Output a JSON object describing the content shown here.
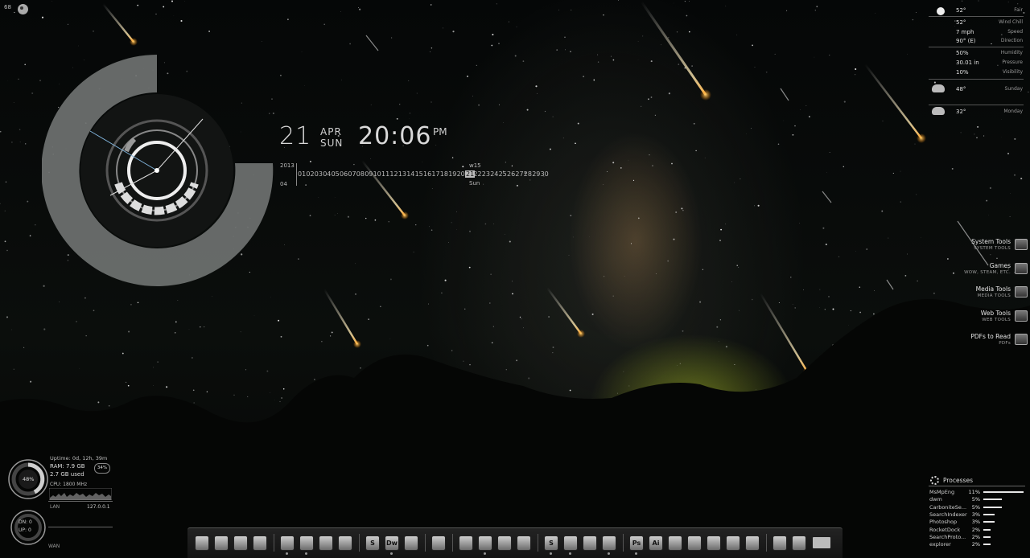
{
  "top_left": {
    "counter": "68"
  },
  "clock": {
    "date_num": "21",
    "month": "APR",
    "day": "SUN",
    "time": "20:06",
    "ampm": "PM",
    "year": "2013",
    "month_num": "04",
    "week": "w15",
    "days": [
      "01",
      "02",
      "03",
      "04",
      "05",
      "06",
      "07",
      "08",
      "09",
      "10",
      "11",
      "12",
      "13",
      "14",
      "15",
      "16",
      "17",
      "18",
      "19",
      "20",
      "21",
      "22",
      "23",
      "24",
      "25",
      "26",
      "27",
      "28",
      "29",
      "30"
    ],
    "today": "21",
    "today_label": "Sun"
  },
  "weather": {
    "rows": [
      {
        "value": "52°",
        "label": "Fair"
      },
      {
        "value": "52°",
        "label": "Wind Chill"
      },
      {
        "value": "7 mph",
        "label": "Speed"
      },
      {
        "value": "90° (E)",
        "label": "Direction"
      },
      {
        "value": "50%",
        "label": "Humidity"
      },
      {
        "value": "30.01 in",
        "label": "Pressure"
      },
      {
        "value": "10%",
        "label": "Visibility"
      }
    ],
    "forecast": [
      {
        "temp": "48°",
        "day": "Sunday",
        "icon": "moon-cloud-icon"
      },
      {
        "temp": "32°",
        "day": "Monday",
        "icon": "rain-cloud-icon"
      }
    ]
  },
  "launcher": [
    {
      "title": "System Tools",
      "sub": "SYSTEM TOOLS",
      "icon": "system-tools-icon"
    },
    {
      "title": "Games",
      "sub": "WOW, STEAM, ETC.",
      "icon": "games-icon"
    },
    {
      "title": "Media Tools",
      "sub": "MEDIA TOOLS",
      "icon": "media-tools-icon"
    },
    {
      "title": "Web Tools",
      "sub": "WEB TOOLS",
      "icon": "web-tools-icon"
    },
    {
      "title": "PDFs to Read",
      "sub": "PDFs",
      "icon": "pdf-icon"
    }
  ],
  "system": {
    "cpu_pct": "48%",
    "uptime": "Uptime:  0d, 12h, 39m",
    "ram": "RAM: 7.9 GB",
    "used": "2.7 GB used",
    "ram_pct": "34%",
    "cpu_label": "CPU: 1800 MHz",
    "lan": "LAN",
    "ip": "127.0.0.1",
    "dn": "DN: 0",
    "up": "UP: 0",
    "wan": "WAN"
  },
  "processes": {
    "title": "Processes",
    "items": [
      {
        "name": "MsMpEng",
        "pct": "11%",
        "fraction": 1.0
      },
      {
        "name": "dwm",
        "pct": "5%",
        "fraction": 0.45
      },
      {
        "name": "CarboniteSe...",
        "pct": "5%",
        "fraction": 0.45
      },
      {
        "name": "SearchIndexer",
        "pct": "3%",
        "fraction": 0.27
      },
      {
        "name": "Photoshop",
        "pct": "3%",
        "fraction": 0.27
      },
      {
        "name": "RocketDock",
        "pct": "2%",
        "fraction": 0.18
      },
      {
        "name": "SearchProto...",
        "pct": "2%",
        "fraction": 0.18
      },
      {
        "name": "explorer",
        "pct": "2%",
        "fraction": 0.18
      }
    ]
  },
  "dock": {
    "icons": [
      {
        "name": "computer-icon",
        "glyph": ""
      },
      {
        "name": "network-icon",
        "glyph": ""
      },
      {
        "name": "monitor-icon",
        "glyph": ""
      },
      {
        "name": "phone-icon",
        "glyph": ""
      },
      {
        "name": "folder-icon",
        "glyph": ""
      },
      {
        "name": "printer-icon",
        "glyph": ""
      },
      {
        "name": "document-icon",
        "glyph": ""
      },
      {
        "name": "notes-icon",
        "glyph": ""
      },
      {
        "name": "sublime-icon",
        "glyph": "S"
      },
      {
        "name": "dreamweaver-icon",
        "glyph": "Dw"
      },
      {
        "name": "filezilla-icon",
        "glyph": ""
      },
      {
        "name": "book-icon",
        "glyph": ""
      },
      {
        "name": "chrome-icon",
        "glyph": ""
      },
      {
        "name": "firefox-icon",
        "glyph": ""
      },
      {
        "name": "opera-icon",
        "glyph": ""
      },
      {
        "name": "itunes-icon",
        "glyph": ""
      },
      {
        "name": "skype-icon",
        "glyph": "S"
      },
      {
        "name": "paint-icon",
        "glyph": ""
      },
      {
        "name": "sketch-icon",
        "glyph": ""
      },
      {
        "name": "smile-icon",
        "glyph": ""
      },
      {
        "name": "photoshop-icon",
        "glyph": "Ps"
      },
      {
        "name": "illustrator-icon",
        "glyph": "Ai"
      },
      {
        "name": "acrobat-icon",
        "glyph": ""
      },
      {
        "name": "wordpress-icon",
        "glyph": ""
      },
      {
        "name": "steam-icon",
        "glyph": ""
      },
      {
        "name": "game-icon",
        "glyph": ""
      },
      {
        "name": "world-icon",
        "glyph": ""
      },
      {
        "name": "drop-icon",
        "glyph": ""
      },
      {
        "name": "recycle-bin-icon",
        "glyph": ""
      }
    ]
  }
}
